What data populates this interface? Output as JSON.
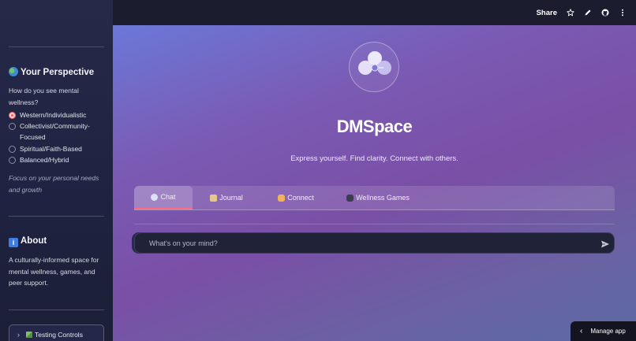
{
  "sidebar": {
    "perspective_heading": "Your Perspective",
    "question": "How do you see mental wellness?",
    "options": [
      {
        "label": "Western/Individualistic",
        "selected": true
      },
      {
        "label": "Collectivist/Community-Focused",
        "selected": false
      },
      {
        "label": "Spiritual/Faith-Based",
        "selected": false
      },
      {
        "label": "Balanced/Hybrid",
        "selected": false
      }
    ],
    "perspective_note": "Focus on your personal needs and growth",
    "about_heading": "About",
    "about_text": "A culturally-informed space for mental wellness, games, and peer support.",
    "testing_label": "Testing Controls",
    "info_glyph": "i"
  },
  "topbar": {
    "share_label": "Share"
  },
  "main": {
    "title": "DMSpace",
    "tagline": "Express yourself. Find clarity. Connect with others.",
    "tabs": [
      {
        "label": "Chat",
        "icon": "speech-bubble-icon",
        "color": "#d9dcf5"
      },
      {
        "label": "Journal",
        "icon": "scroll-icon",
        "color": "#e6c78a"
      },
      {
        "label": "Connect",
        "icon": "handshake-icon",
        "color": "#f0b35a"
      },
      {
        "label": "Wellness Games",
        "icon": "gamepad-icon",
        "color": "#3a3c4f"
      }
    ],
    "chat_placeholder": "What's on your mind?"
  },
  "manage_app_label": "Manage app",
  "colors": {
    "accent": "#ff6b7d",
    "radio_selected": "#ff5a5a"
  }
}
